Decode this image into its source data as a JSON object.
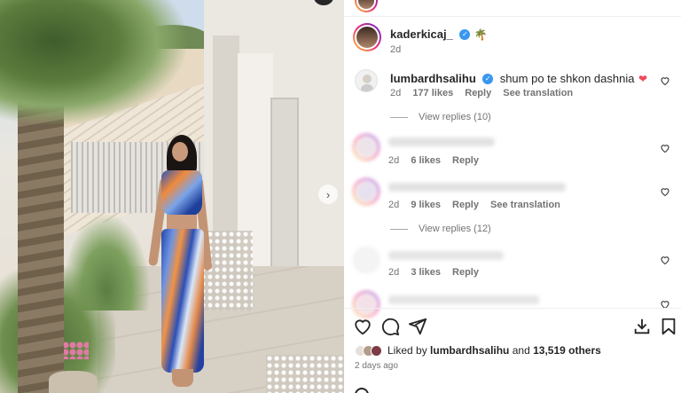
{
  "post": {
    "author": "kaderkicaj_",
    "author_emoji": "🌴",
    "time": "2d"
  },
  "comments": [
    {
      "user": "lumbardhsalihu",
      "verified": true,
      "text": "shum po te shkon dashnia",
      "emoji": "❤️",
      "time": "2d",
      "likes": "177 likes",
      "reply": "Reply",
      "translate": "See translation",
      "view_replies": "View replies (10)"
    },
    {
      "user": "alb",
      "verified": false,
      "text": "",
      "time": "2d",
      "likes": "6 likes",
      "reply": "Reply"
    },
    {
      "user": "",
      "verified": false,
      "text": "",
      "time": "2d",
      "likes": "9 likes",
      "reply": "Reply",
      "translate": "See translation",
      "view_replies": "View replies (12)"
    },
    {
      "user": "",
      "verified": false,
      "text": "",
      "time": "2d",
      "likes": "3 likes",
      "reply": "Reply"
    },
    {
      "user": "",
      "verified": false,
      "text": "",
      "time": "",
      "likes": "",
      "reply": ""
    }
  ],
  "actions": {
    "like_icon": "heart-icon",
    "comment_icon": "comment-icon",
    "share_icon": "send-icon",
    "save_icon": "bookmark-icon",
    "download_icon": "download-icon"
  },
  "likes": {
    "prefix": "Liked by",
    "user": "lumbardhsalihu",
    "suffix": "and",
    "others": "13,519 others"
  },
  "posted_ago": "2 days ago",
  "colors": {
    "verified": "#3897f0",
    "heart": "#ed4956",
    "muted": "#737373"
  }
}
